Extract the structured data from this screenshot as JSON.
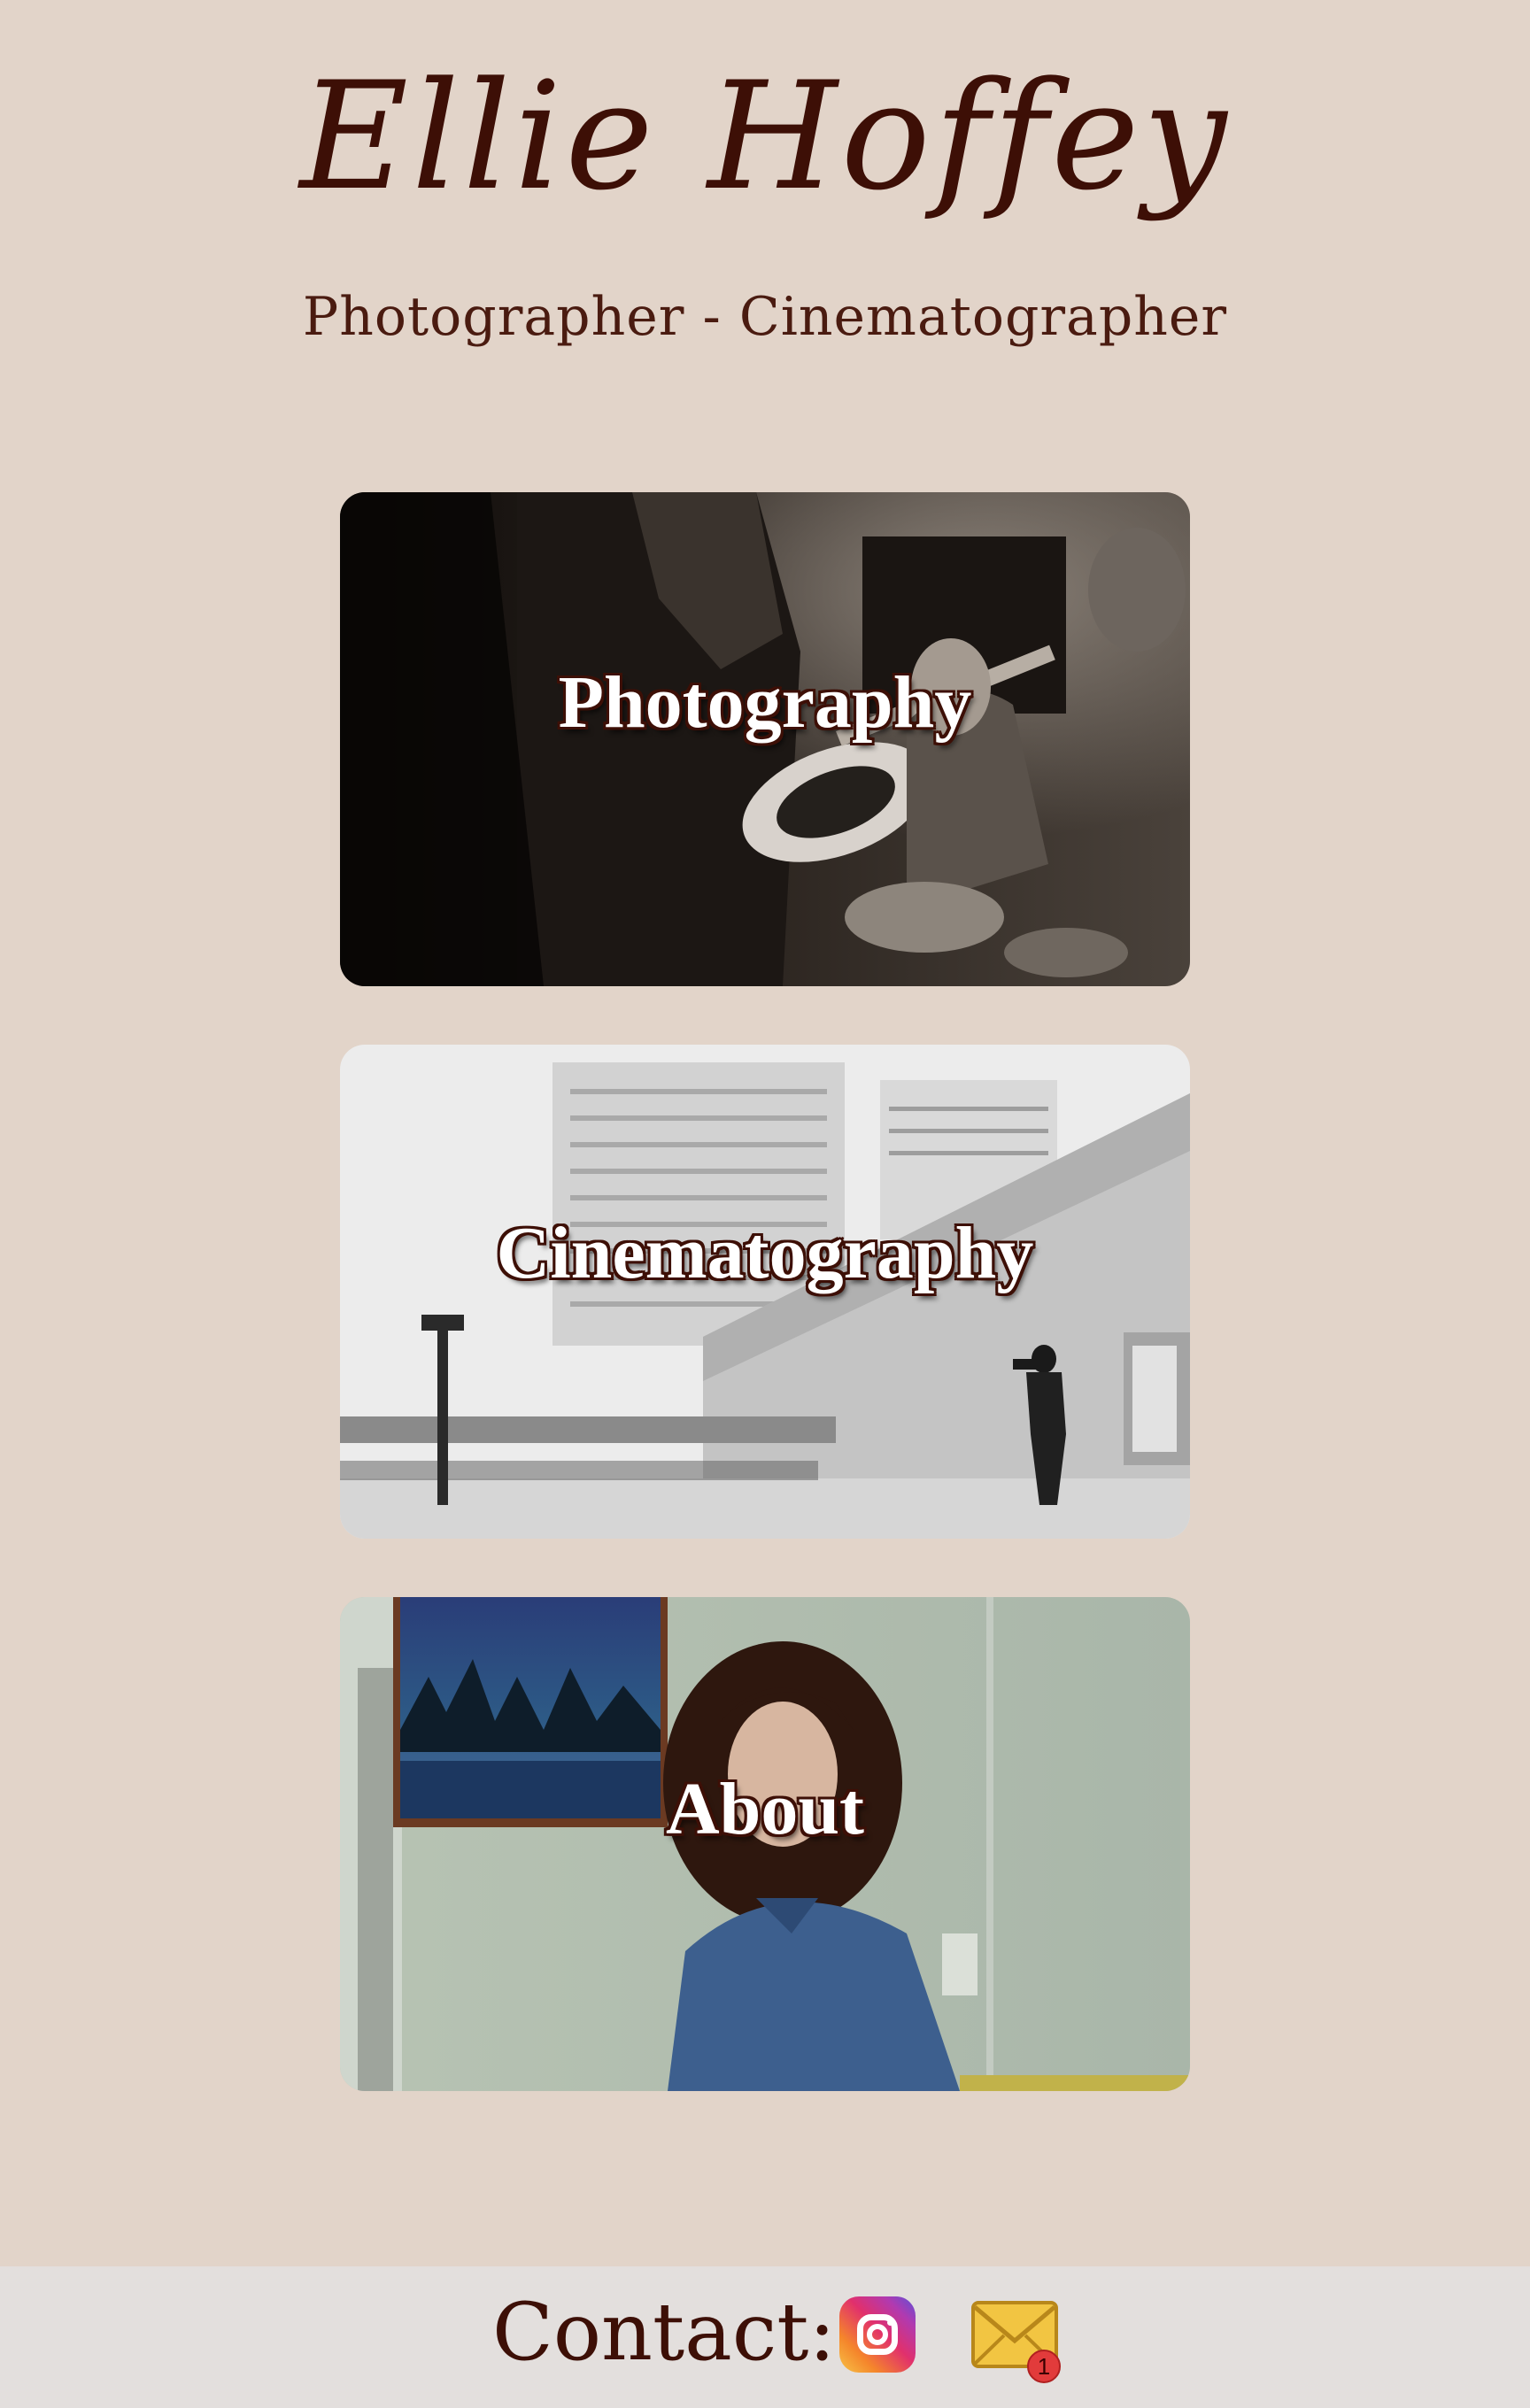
{
  "header": {
    "title": "Ellie Hoffey",
    "subtitle": "Photographer - Cinematographer"
  },
  "cards": [
    {
      "label": "Photography"
    },
    {
      "label": "Cinematography"
    },
    {
      "label": "About"
    }
  ],
  "footer": {
    "contact_label": "Contact:",
    "mail_badge_count": "1",
    "icons": [
      "instagram-icon",
      "mail-icon"
    ]
  },
  "colors": {
    "background": "#e2d4c9",
    "footer_background": "#e3dfdd",
    "text": "#3d0f06",
    "label_outline": "#3d0f06"
  }
}
